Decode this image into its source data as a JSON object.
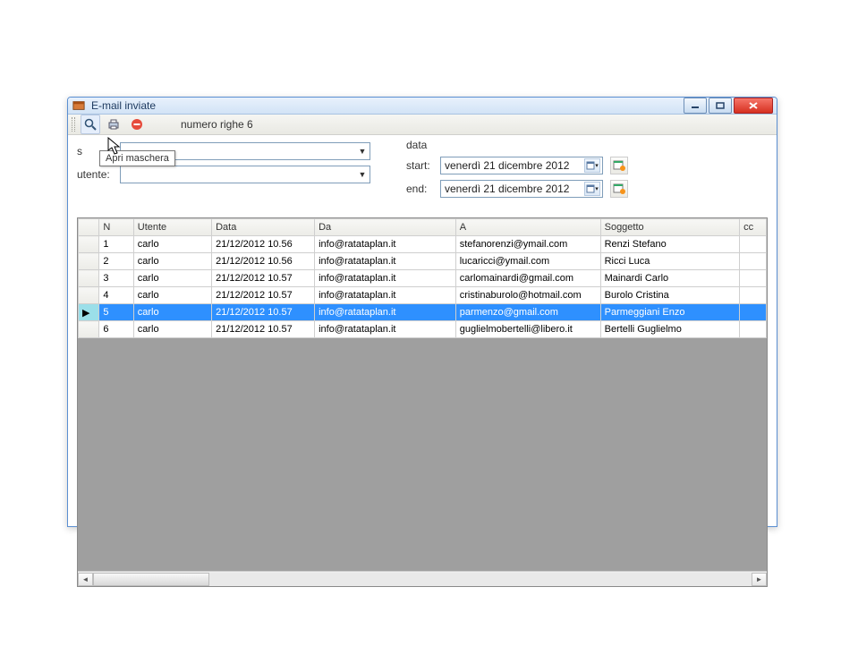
{
  "window": {
    "title": "E-mail inviate"
  },
  "toolbar": {
    "status": "numero righe 6",
    "tooltip": "Apri maschera"
  },
  "filters": {
    "first_label": "s",
    "utente_label": "utente:",
    "first_value": "",
    "utente_value": ""
  },
  "dates": {
    "group_label": "data",
    "start_label": "start:",
    "end_label": "end:",
    "start_value": "venerdì  21 dicembre 2012",
    "end_value": "venerdì  21 dicembre 2012"
  },
  "grid": {
    "columns": [
      "",
      "N",
      "Utente",
      "Data",
      "Da",
      "A",
      "Soggetto",
      "cc"
    ],
    "selected_index": 4,
    "rows": [
      {
        "n": "1",
        "utente": "carlo",
        "data": "21/12/2012 10.56",
        "da": "info@ratataplan.it",
        "a": "stefanorenzi@ymail.com",
        "sog": "Renzi Stefano",
        "cc": ""
      },
      {
        "n": "2",
        "utente": "carlo",
        "data": "21/12/2012 10.56",
        "da": "info@ratataplan.it",
        "a": "lucaricci@ymail.com",
        "sog": "Ricci Luca",
        "cc": ""
      },
      {
        "n": "3",
        "utente": "carlo",
        "data": "21/12/2012 10.57",
        "da": "info@ratataplan.it",
        "a": "carlomainardi@gmail.com",
        "sog": "Mainardi Carlo",
        "cc": ""
      },
      {
        "n": "4",
        "utente": "carlo",
        "data": "21/12/2012 10.57",
        "da": "info@ratataplan.it",
        "a": "cristinaburolo@hotmail.com",
        "sog": "Burolo Cristina",
        "cc": ""
      },
      {
        "n": "5",
        "utente": "carlo",
        "data": "21/12/2012 10.57",
        "da": "info@ratataplan.it",
        "a": "parmenzo@gmail.com",
        "sog": "Parmeggiani Enzo",
        "cc": ""
      },
      {
        "n": "6",
        "utente": "carlo",
        "data": "21/12/2012 10.57",
        "da": "info@ratataplan.it",
        "a": "guglielmobertelli@libero.it",
        "sog": "Bertelli Guglielmo",
        "cc": ""
      }
    ]
  }
}
